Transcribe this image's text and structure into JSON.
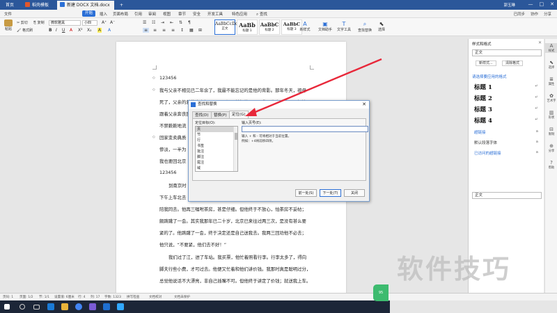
{
  "titlebar": {
    "tabs": [
      {
        "label": "首页",
        "color": "#ffffff"
      },
      {
        "label": "稻壳模板",
        "color": "#e2572b"
      },
      {
        "label": "新建 DOCX 文档.docx",
        "color": "#2b6fd6"
      }
    ],
    "user": "郭玉琳"
  },
  "menubar": {
    "items": [
      "文件",
      "开始",
      "插入",
      "页面布局",
      "引用",
      "审阅",
      "视图",
      "章节",
      "安全",
      "开发工具",
      "特色应用",
      "查找"
    ],
    "right": [
      "已同步",
      "协作",
      "分享"
    ]
  },
  "ribbon": {
    "paste": "粘贴",
    "cut": "剪切",
    "copy": "复制",
    "format_painter": "格式刷",
    "font_name": "微软雅黑",
    "font_size": "小四",
    "styles": [
      {
        "preview": "AaBbCcDd",
        "name": "正文"
      },
      {
        "preview": "AaBb",
        "name": "标题 1"
      },
      {
        "preview": "AaBbC",
        "name": "标题 2"
      },
      {
        "preview": "AaBbC",
        "name": "标题 3"
      }
    ],
    "new_style": "新样式",
    "text_assistant": "文档助手",
    "text_tools": "文字工具",
    "find_replace": "查找替换",
    "select": "选择"
  },
  "document": {
    "lines": [
      "123456",
      "我与父亲不相见已二年余了，我最不能忘记的是他的背影。那年冬天，祖母",
      "死了，父亲的差使也交卸了，正是祸不单行的日子，我从北京到徐州，打算",
      "跟着父亲奔丧回家。",
      "不禁簌簌地流",
      "回家变卖典质",
      "惨淡，一半为",
      "我也要回北京",
      "123456",
      "到南京时",
      "下午上车北去",
      "陪我同去。他再三嘱咐茶房，甚是仔细。但他终于不放心，怕茶房不妥帖；",
      "颇踌躇了一会。其实我那年已二十岁，北京已来往过两三次，是没有甚么要",
      "紧的了。他踌躇了一会，终于决定还是自己送我去。我两三回劝他不必去；",
      "他只说，“不要紧，他们去不好！”",
      "我们过了江，进了车站。我买票，他忙着照看行李。行李太多了，得向",
      "脚夫行些小费，才可过去。他便又忙着和他们讲价钱。我那时真是聪明过分，",
      "总觉他说话不大漂亮，非自己插嘴不可。但他终于讲定了价钱；就送我上车。"
    ]
  },
  "dialog": {
    "title": "查找和替换",
    "tabs": [
      "查找(D)",
      "替换(P)",
      "定位(G)"
    ],
    "target_label": "定位目标(O):",
    "targets": [
      "页",
      "节",
      "行",
      "书签",
      "批注",
      "脚注",
      "尾注",
      "域"
    ],
    "selected_target": "页",
    "page_label": "输入页号(E):",
    "page_value": "",
    "hint": "输入 + 和 - 可将相对于当前位置。\n例如：+4将前移四项。",
    "buttons": {
      "prev": "前一处(S)",
      "next": "下一处(T)",
      "close": "关闭"
    }
  },
  "right_panel": {
    "title": "样式和格式",
    "current_style": "正文",
    "new_style_btn": "新样式...",
    "clear_format_btn": "清除格式",
    "apply_prompt": "请选择要应用的格式",
    "headings": [
      "标题 1",
      "标题 2",
      "标题 3",
      "标题 4"
    ],
    "items": [
      "超链接",
      "默认段落字体",
      "已访问的超链接"
    ],
    "normal": "正文"
  },
  "right_strip": [
    "样式",
    "选择",
    "属性",
    "艺术字",
    "形状",
    "限制",
    "分享",
    "帮助"
  ],
  "statusbar": {
    "page": "页码: 1",
    "pages": "页面: 1/2",
    "section": "节: 1/1",
    "setting": "设置值: 6厘米",
    "row": "行: 4",
    "col": "列: 17",
    "words": "字数: 1323",
    "spell": "拼写检查",
    "proof": "文档校对",
    "unsaved": "文档未保护"
  },
  "watermark": "软件技巧",
  "badge": "95",
  "colors": {
    "accent": "#2b6fd6",
    "titlebar": "#2b579a",
    "arrow": "#e8283a"
  }
}
